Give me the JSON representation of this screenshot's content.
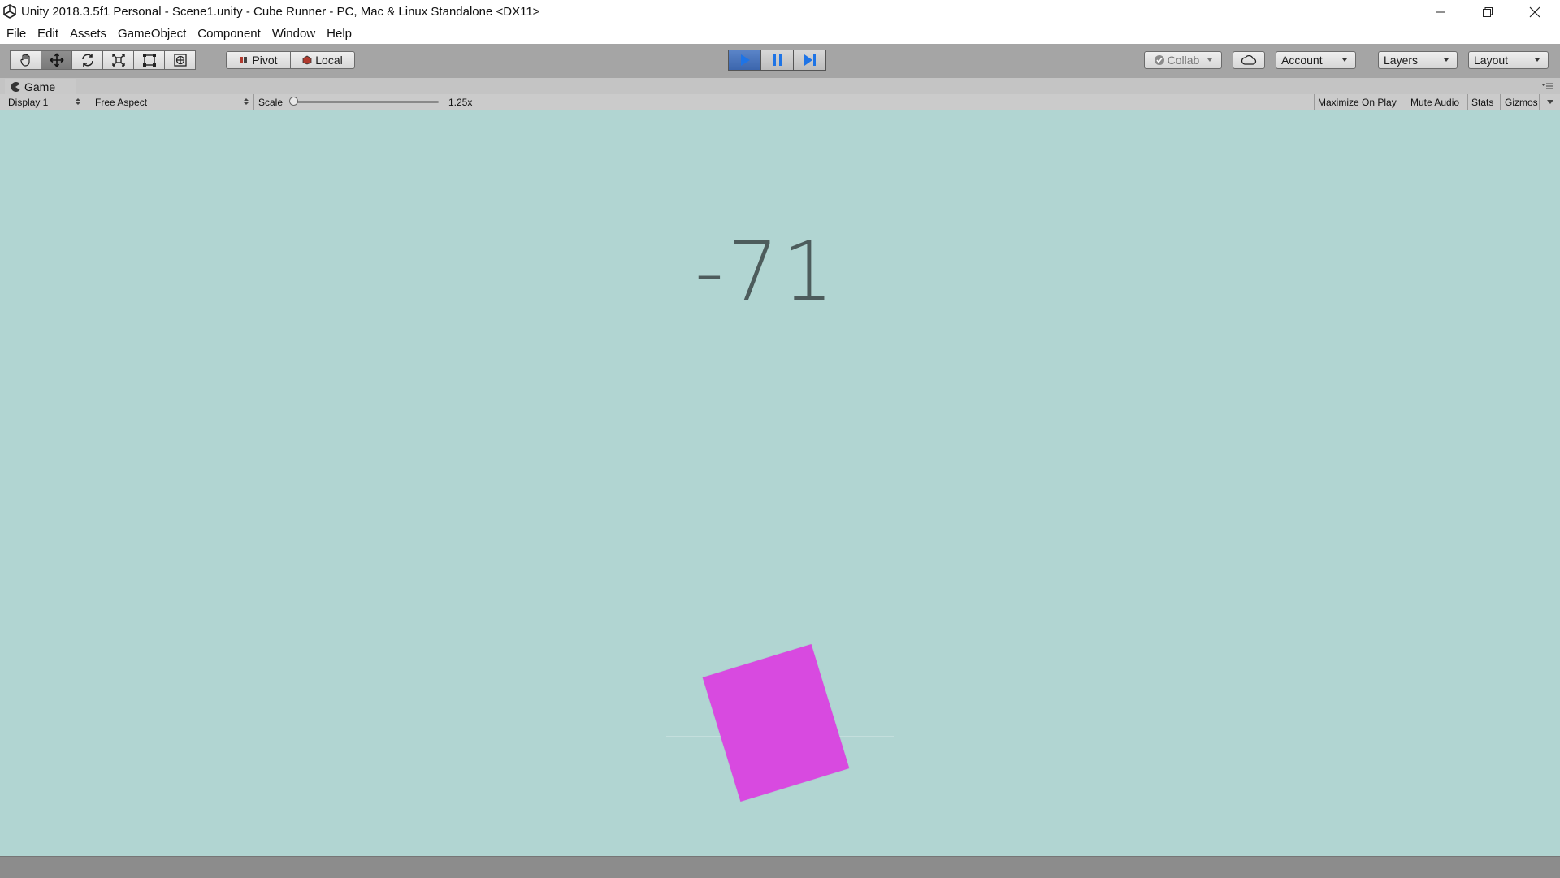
{
  "window": {
    "title": "Unity 2018.3.5f1 Personal - Scene1.unity - Cube Runner - PC, Mac & Linux Standalone <DX11>"
  },
  "menu": [
    "File",
    "Edit",
    "Assets",
    "GameObject",
    "Component",
    "Window",
    "Help"
  ],
  "toolbar": {
    "transform_tools": [
      "hand-tool-icon",
      "move-tool-icon",
      "rotate-tool-icon",
      "scale-tool-icon",
      "rect-tool-icon",
      "transform-tool-icon"
    ],
    "pivot_label": "Pivot",
    "local_label": "Local",
    "collab_label": "Collab",
    "account_label": "Account",
    "layers_label": "Layers",
    "layout_label": "Layout"
  },
  "panel": {
    "tab_label": "Game",
    "display_label": "Display 1",
    "aspect_label": "Free Aspect",
    "scale_label": "Scale",
    "scale_value": "1.25x",
    "maximize_label": "Maximize On Play",
    "mute_label": "Mute Audio",
    "stats_label": "Stats",
    "gizmos_label": "Gizmos"
  },
  "game": {
    "score": "-71",
    "cube_color": "#d84ae0",
    "background_color": "#b1d5d2"
  },
  "colors": {
    "play_active": "#3c66ad",
    "toolbar": "#a5a5a5"
  }
}
